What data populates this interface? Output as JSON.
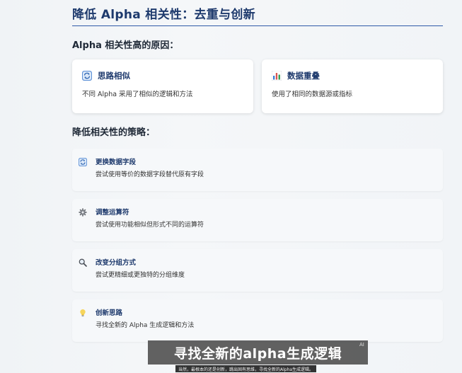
{
  "title": "降低 Alpha 相关性：去重与创新",
  "reasons": {
    "heading": "Alpha 相关性高的原因：",
    "cards": [
      {
        "icon": "refresh-icon",
        "title": "思路相似",
        "desc": "不同 Alpha 采用了相似的逻辑和方法"
      },
      {
        "icon": "bar-chart-icon",
        "title": "数据重叠",
        "desc": "使用了相同的数据源或指标"
      }
    ]
  },
  "strategies": {
    "heading": "降低相关性的策略：",
    "items": [
      {
        "icon": "refresh-icon",
        "title": "更换数据字段",
        "desc": "尝试使用等价的数据字段替代原有字段"
      },
      {
        "icon": "gear-icon",
        "title": "调整运算符",
        "desc": "尝试使用功能相似但形式不同的运算符"
      },
      {
        "icon": "magnifier-icon",
        "title": "改变分组方式",
        "desc": "尝试更精细或更独特的分组维度"
      },
      {
        "icon": "lightbulb-icon",
        "title": "创新思路",
        "desc": "寻找全新的 Alpha 生成逻辑和方法"
      }
    ]
  },
  "captions": {
    "main": "寻找全新的alpha生成逻辑",
    "badge": "AI",
    "small": "当然，最根本的还是创新，跳出固有思维，寻找全新的Alpha生成逻辑。"
  },
  "colors": {
    "title": "#1e3a6d",
    "rule": "#2f5aa8",
    "card_bg": "#ffffff",
    "strategy_bg": "#f6f8fa"
  }
}
